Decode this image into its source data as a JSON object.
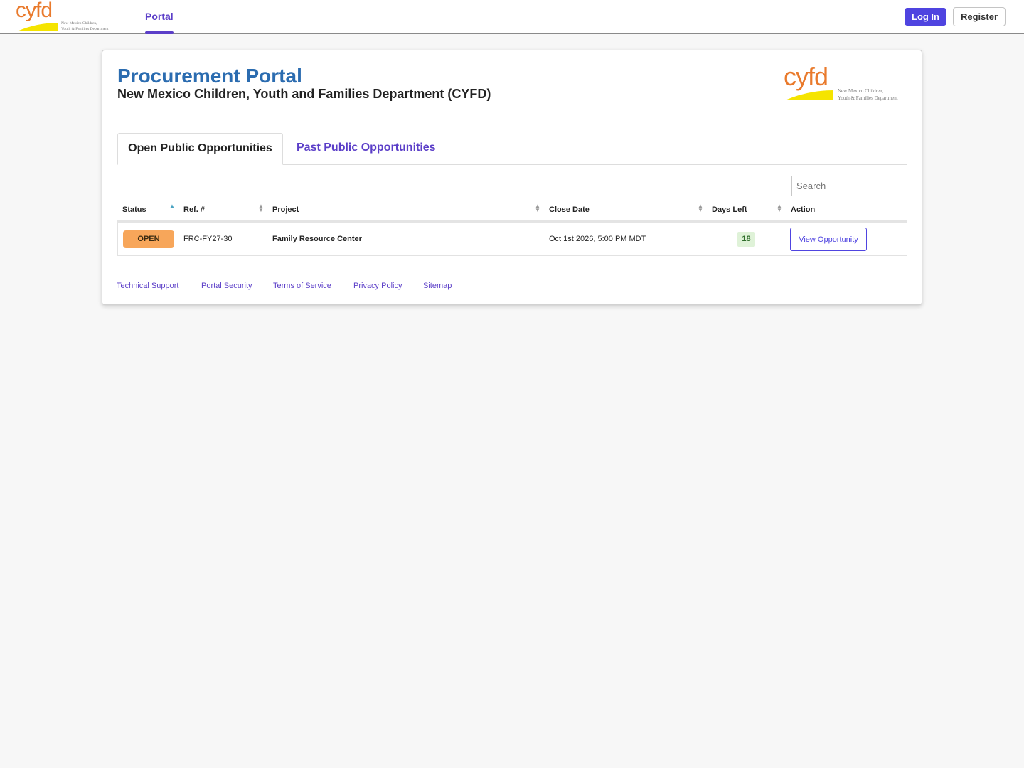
{
  "brand": {
    "logo_text": "cyfd",
    "tagline_line1": "New Mexico Children,",
    "tagline_line2": "Youth & Families Department",
    "colors": {
      "logo_orange": "#e97a2c",
      "swoosh_yellow": "#f5e400",
      "accent_purple": "#5b3ec8",
      "title_blue": "#2b6cb0"
    }
  },
  "nav": {
    "portal_label": "Portal",
    "login_label": "Log In",
    "register_label": "Register"
  },
  "header": {
    "title": "Procurement Portal",
    "subtitle": "New Mexico Children, Youth and Families Department (CYFD)"
  },
  "tabs": [
    {
      "label": "Open Public Opportunities",
      "active": true
    },
    {
      "label": "Past Public Opportunities",
      "active": false
    }
  ],
  "search": {
    "placeholder": "Search",
    "value": ""
  },
  "table": {
    "columns": [
      "Status",
      "Ref. #",
      "Project",
      "Close Date",
      "Days Left",
      "Action"
    ],
    "rows": [
      {
        "status": "OPEN",
        "ref": "FRC-FY27-30",
        "project": "Family Resource Center",
        "close_date": "Oct 1st 2026, 5:00 PM MDT",
        "days_left": "18",
        "action": "View Opportunity"
      }
    ]
  },
  "footer": {
    "links": [
      "Technical Support",
      "Portal Security",
      "Terms of Service",
      "Privacy Policy",
      "Sitemap"
    ]
  }
}
